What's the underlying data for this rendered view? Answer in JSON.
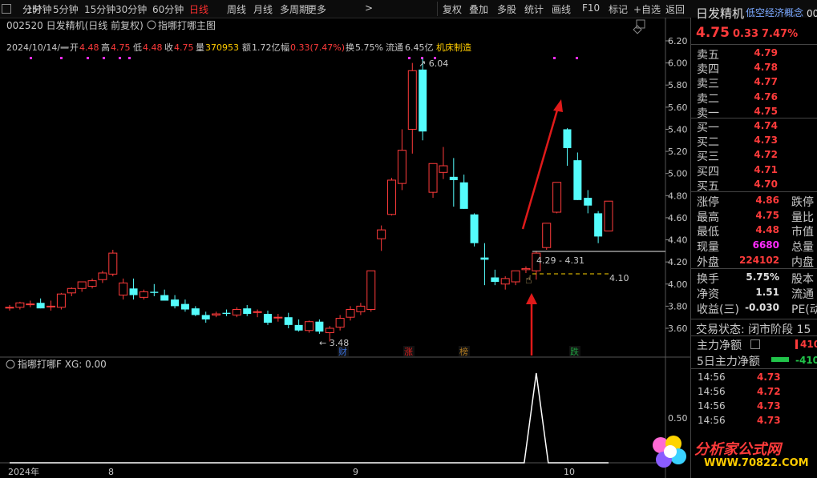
{
  "toolbar": {
    "left": [
      "分时",
      "1分钟",
      "5分钟",
      "15分钟",
      "30分钟",
      "60分钟",
      "日线",
      "周线",
      "月线",
      "多周期",
      "更多"
    ],
    "active": "日线",
    "more_arrow": ">",
    "right": [
      "复权",
      "叠加",
      "多股",
      "统计",
      "画线",
      "F10",
      "标记",
      "+自选",
      "返回"
    ]
  },
  "chart": {
    "title": "002520 日发精机(日线 前复权)",
    "indicator_name": "指哪打哪主图",
    "ohlc": {
      "date": "2024/10/14/一",
      "open_label": "开",
      "open": "4.48",
      "high_label": "高",
      "high": "4.75",
      "low_label": "低",
      "low": "4.48",
      "close_label": "收",
      "close": "4.75",
      "vol_label": "量",
      "vol": "370953",
      "amount_label": "额",
      "amount": "1.72亿",
      "chg_label": "幅",
      "chg": "0.33(7.47%)",
      "turnover_label": "换",
      "turnover": "5.75%",
      "float_label": "流通",
      "float": "6.45亿",
      "industry": "机床制造"
    },
    "y_ticks": [
      "6.20",
      "6.00",
      "5.80",
      "5.60",
      "5.40",
      "5.20",
      "5.00",
      "4.80",
      "4.60",
      "4.40",
      "4.20",
      "4.00",
      "3.80",
      "3.60"
    ],
    "max_label": "6.04",
    "min_label": "3.48",
    "range_label": "4.29 - 4.31",
    "level_label": "4.10",
    "badges": [
      "财",
      "涨",
      "榜",
      "跌"
    ],
    "x_labels": [
      "2024年",
      "8",
      "9",
      "10"
    ],
    "sub_title": "指哪打哪F  XG: 0.00",
    "sub_tick": "0.50"
  },
  "colors": {
    "up": "#ff3b3b",
    "down": "#54fcfc",
    "bg": "#000000"
  },
  "panel": {
    "name": "日发精机",
    "concept": "低空经济概念",
    "code_cut": "00",
    "price": "4.75",
    "change": "0.33",
    "pct": "7.47%",
    "asks": [
      [
        "卖五",
        "4.79"
      ],
      [
        "卖四",
        "4.78"
      ],
      [
        "卖三",
        "4.77"
      ],
      [
        "卖二",
        "4.76"
      ],
      [
        "卖一",
        "4.75"
      ]
    ],
    "bids": [
      [
        "买一",
        "4.74"
      ],
      [
        "买二",
        "4.73"
      ],
      [
        "买三",
        "4.72"
      ],
      [
        "买四",
        "4.71"
      ],
      [
        "买五",
        "4.70"
      ]
    ],
    "stats": [
      [
        "涨停",
        "4.86",
        "跌停"
      ],
      [
        "最高",
        "4.75",
        "量比"
      ],
      [
        "最低",
        "4.48",
        "市值"
      ],
      [
        "现量",
        "6680",
        "总量"
      ],
      [
        "外盘",
        "224102",
        "内盘"
      ],
      [
        "换手",
        "5.75%",
        "股本"
      ],
      [
        "净资",
        "1.51",
        "流通"
      ],
      [
        "收益(三)",
        "-0.030",
        "PE(动"
      ]
    ],
    "trade_status": "交易状态: 闭市阶段 15",
    "main_net": "主力净额",
    "main_net_val": "410",
    "net5": "5日主力净额",
    "net5_val": "-410",
    "ticks": [
      [
        "14:56",
        "4.73"
      ],
      [
        "14:56",
        "4.72"
      ],
      [
        "14:56",
        "4.73"
      ],
      [
        "14:56",
        "4.73"
      ]
    ]
  },
  "watermark": {
    "line1": "分析家公式网",
    "line2": "WWW.70822.COM"
  },
  "chart_data": {
    "type": "candlestick",
    "candles": [
      {
        "o": 3.79,
        "h": 3.81,
        "l": 3.76,
        "c": 3.79
      },
      {
        "o": 3.79,
        "h": 3.84,
        "l": 3.77,
        "c": 3.83
      },
      {
        "o": 3.82,
        "h": 3.85,
        "l": 3.79,
        "c": 3.82
      },
      {
        "o": 3.83,
        "h": 3.87,
        "l": 3.78,
        "c": 3.78
      },
      {
        "o": 3.8,
        "h": 3.85,
        "l": 3.76,
        "c": 3.8
      },
      {
        "o": 3.79,
        "h": 3.92,
        "l": 3.77,
        "c": 3.91
      },
      {
        "o": 3.92,
        "h": 3.97,
        "l": 3.89,
        "c": 3.96
      },
      {
        "o": 3.96,
        "h": 4.02,
        "l": 3.93,
        "c": 4.02
      },
      {
        "o": 3.98,
        "h": 4.05,
        "l": 3.96,
        "c": 4.03
      },
      {
        "o": 4.04,
        "h": 4.12,
        "l": 4.01,
        "c": 4.1
      },
      {
        "o": 4.09,
        "h": 4.31,
        "l": 4.07,
        "c": 4.28
      },
      {
        "o": 3.9,
        "h": 4.05,
        "l": 3.86,
        "c": 4.01
      },
      {
        "o": 3.96,
        "h": 4.05,
        "l": 3.86,
        "c": 3.9
      },
      {
        "o": 3.88,
        "h": 3.95,
        "l": 3.86,
        "c": 3.93
      },
      {
        "o": 3.93,
        "h": 4.0,
        "l": 3.89,
        "c": 3.92
      },
      {
        "o": 3.9,
        "h": 3.95,
        "l": 3.86,
        "c": 3.85
      },
      {
        "o": 3.86,
        "h": 3.9,
        "l": 3.78,
        "c": 3.8
      },
      {
        "o": 3.82,
        "h": 3.86,
        "l": 3.75,
        "c": 3.77
      },
      {
        "o": 3.78,
        "h": 3.8,
        "l": 3.71,
        "c": 3.72
      },
      {
        "o": 3.72,
        "h": 3.75,
        "l": 3.65,
        "c": 3.68
      },
      {
        "o": 3.72,
        "h": 3.75,
        "l": 3.7,
        "c": 3.73
      },
      {
        "o": 3.74,
        "h": 3.77,
        "l": 3.71,
        "c": 3.73
      },
      {
        "o": 3.72,
        "h": 3.79,
        "l": 3.7,
        "c": 3.77
      },
      {
        "o": 3.78,
        "h": 3.81,
        "l": 3.71,
        "c": 3.73
      },
      {
        "o": 3.75,
        "h": 3.77,
        "l": 3.7,
        "c": 3.75
      },
      {
        "o": 3.73,
        "h": 3.76,
        "l": 3.63,
        "c": 3.65
      },
      {
        "o": 3.7,
        "h": 3.73,
        "l": 3.66,
        "c": 3.7
      },
      {
        "o": 3.7,
        "h": 3.74,
        "l": 3.6,
        "c": 3.63
      },
      {
        "o": 3.63,
        "h": 3.68,
        "l": 3.57,
        "c": 3.58
      },
      {
        "o": 3.58,
        "h": 3.67,
        "l": 3.56,
        "c": 3.66
      },
      {
        "o": 3.66,
        "h": 3.68,
        "l": 3.55,
        "c": 3.57
      },
      {
        "o": 3.56,
        "h": 3.62,
        "l": 3.48,
        "c": 3.6
      },
      {
        "o": 3.61,
        "h": 3.72,
        "l": 3.58,
        "c": 3.69
      },
      {
        "o": 3.7,
        "h": 3.8,
        "l": 3.67,
        "c": 3.77
      },
      {
        "o": 3.75,
        "h": 3.83,
        "l": 3.72,
        "c": 3.8
      },
      {
        "o": 3.77,
        "h": 4.12,
        "l": 3.75,
        "c": 4.12
      },
      {
        "o": 4.41,
        "h": 4.53,
        "l": 4.3,
        "c": 4.49
      },
      {
        "o": 4.63,
        "h": 4.96,
        "l": 4.62,
        "c": 4.94
      },
      {
        "o": 4.91,
        "h": 5.4,
        "l": 4.85,
        "c": 5.21
      },
      {
        "o": 5.4,
        "h": 6.0,
        "l": 5.18,
        "c": 5.93
      },
      {
        "o": 5.94,
        "h": 6.04,
        "l": 5.3,
        "c": 5.38
      },
      {
        "o": 4.83,
        "h": 5.07,
        "l": 4.78,
        "c": 5.09
      },
      {
        "o": 5.01,
        "h": 5.24,
        "l": 4.95,
        "c": 5.07
      },
      {
        "o": 4.97,
        "h": 5.14,
        "l": 4.7,
        "c": 4.94
      },
      {
        "o": 4.92,
        "h": 4.99,
        "l": 4.68,
        "c": 4.68
      },
      {
        "o": 4.63,
        "h": 4.64,
        "l": 4.34,
        "c": 4.37
      },
      {
        "o": 4.24,
        "h": 4.37,
        "l": 3.99,
        "c": 4.22
      },
      {
        "o": 4.06,
        "h": 4.13,
        "l": 3.99,
        "c": 4.02
      },
      {
        "o": 4.0,
        "h": 4.07,
        "l": 3.95,
        "c": 4.05
      },
      {
        "o": 4.02,
        "h": 4.11,
        "l": 3.99,
        "c": 4.12
      },
      {
        "o": 4.13,
        "h": 4.16,
        "l": 4.1,
        "c": 4.14
      },
      {
        "o": 4.12,
        "h": 4.3,
        "l": 4.04,
        "c": 4.28
      },
      {
        "o": 4.33,
        "h": 4.55,
        "l": 4.31,
        "c": 4.55
      },
      {
        "o": 4.65,
        "h": 4.88,
        "l": 4.64,
        "c": 4.92
      },
      {
        "o": 5.4,
        "h": 5.41,
        "l": 5.07,
        "c": 5.23
      },
      {
        "o": 5.12,
        "h": 5.19,
        "l": 4.76,
        "c": 4.76
      },
      {
        "o": 4.78,
        "h": 4.85,
        "l": 4.64,
        "c": 4.71
      },
      {
        "o": 4.64,
        "h": 4.66,
        "l": 4.37,
        "c": 4.43
      },
      {
        "o": 4.48,
        "h": 4.75,
        "l": 4.48,
        "c": 4.75
      }
    ],
    "y_range": [
      3.48,
      6.28
    ],
    "signal_bar_index": 51,
    "sub_values_note": "signal spike at one bar, 0 elsewhere"
  }
}
